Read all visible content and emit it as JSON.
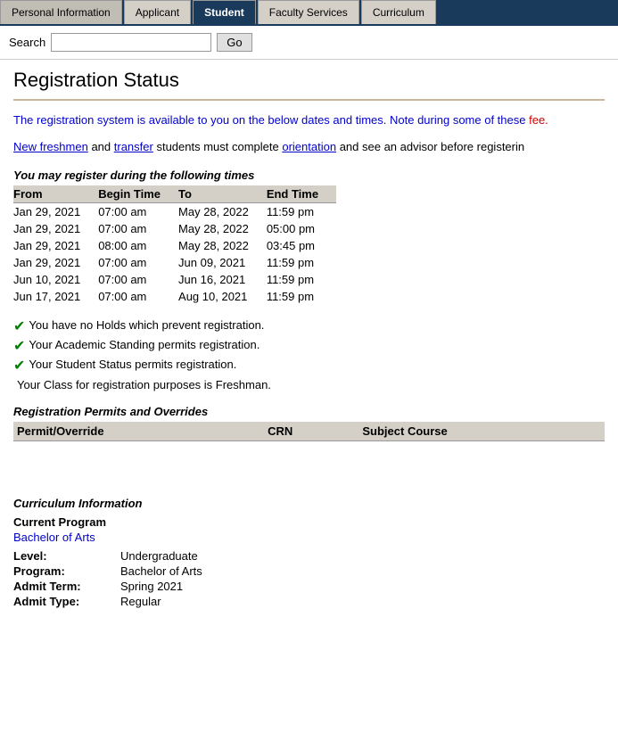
{
  "tabs": [
    {
      "label": "Personal Information",
      "active": false
    },
    {
      "label": "Applicant",
      "active": false
    },
    {
      "label": "Student",
      "active": true
    },
    {
      "label": "Faculty Services",
      "active": false
    },
    {
      "label": "Curriculum",
      "active": false
    }
  ],
  "search": {
    "label": "Search",
    "placeholder": "",
    "button": "Go"
  },
  "page_title": "Registration Status",
  "info_text": "The registration system is available to you on the below dates and times. Note during some of these",
  "info_note": "fee.",
  "freshmen_line": " and ",
  "freshmen_link1": "New freshmen",
  "freshmen_middle": "transfer",
  "freshmen_text2": " students must complete ",
  "freshmen_link2": "orientation",
  "freshmen_text3": " and see an advisor before registerin",
  "reg_times": {
    "title": "You may register during the following times",
    "columns": [
      "From",
      "Begin Time",
      "To",
      "End Time"
    ],
    "rows": [
      [
        "Jan 29, 2021",
        "07:00 am",
        "May 28, 2022",
        "11:59 pm"
      ],
      [
        "Jan 29, 2021",
        "07:00 am",
        "May 28, 2022",
        "05:00 pm"
      ],
      [
        "Jan 29, 2021",
        "08:00 am",
        "May 28, 2022",
        "03:45 pm"
      ],
      [
        "Jan 29, 2021",
        "07:00 am",
        "Jun 09, 2021",
        "11:59 pm"
      ],
      [
        "Jun 10, 2021",
        "07:00 am",
        "Jun 16, 2021",
        "11:59 pm"
      ],
      [
        "Jun 17, 2021",
        "07:00 am",
        "Aug 10, 2021",
        "11:59 pm"
      ]
    ]
  },
  "status_checks": [
    "You have no Holds which prevent registration.",
    "Your Academic Standing permits registration.",
    "Your Student Status permits registration."
  ],
  "class_status": "Your Class for registration purposes is Freshman.",
  "permits": {
    "title": "Registration Permits and Overrides",
    "columns": [
      "Permit/Override",
      "CRN",
      "Subject Course"
    ],
    "rows": []
  },
  "curriculum": {
    "title": "Curriculum Information",
    "current_program_label": "Current Program",
    "current_program_value": "Bachelor of Arts",
    "rows": [
      {
        "label": "Level:",
        "value": "Undergraduate"
      },
      {
        "label": "Program:",
        "value": "Bachelor of Arts"
      },
      {
        "label": "Admit Term:",
        "value": "Spring 2021"
      },
      {
        "label": "Admit Type:",
        "value": "Regular"
      }
    ]
  }
}
